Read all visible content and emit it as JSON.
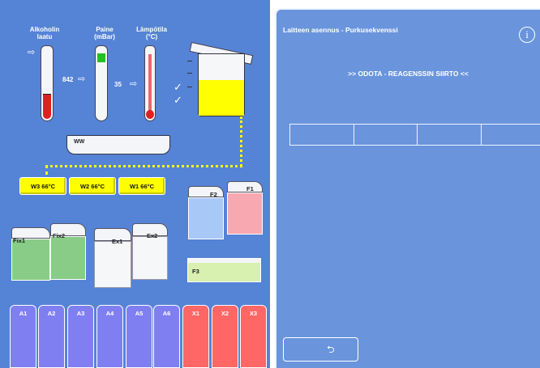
{
  "sensors": {
    "alcohol": {
      "label_line1": "Alkoholin",
      "label_line2": "laatu",
      "value": "842",
      "level": 0.32
    },
    "pressure": {
      "label_line1": "Paine",
      "label_line2": "(mBar)",
      "value": "35",
      "level": 0.1
    },
    "temperature": {
      "label_line1": "Lämpötila",
      "label_line2": "(°C)",
      "level": 0.1
    }
  },
  "ww_label": "WW",
  "wax": [
    {
      "label": "W3 66°C"
    },
    {
      "label": "W2 66°C"
    },
    {
      "label": "W1 66°C"
    }
  ],
  "containers": {
    "fix1": "Fix1",
    "fix2": "Fix2",
    "ex1": "Ex1",
    "ex2": "Ex2",
    "f1": "F1",
    "f2": "F2",
    "f3": "F3"
  },
  "bottles": [
    {
      "label": "A1",
      "color": "#7f7ff2"
    },
    {
      "label": "A2",
      "color": "#7f7ff2"
    },
    {
      "label": "A3",
      "color": "#7f7ff2"
    },
    {
      "label": "A4",
      "color": "#7f7ff2"
    },
    {
      "label": "A5",
      "color": "#7f7ff2"
    },
    {
      "label": "A6",
      "color": "#7f7ff2"
    },
    {
      "label": "X1",
      "color": "#ff6666"
    },
    {
      "label": "X2",
      "color": "#ff6666"
    },
    {
      "label": "X3",
      "color": "#ff6666"
    }
  ],
  "panel": {
    "title": "Laitteen asennus - Purkusekvenssi",
    "status": ">> ODOTA - REAGENSSIN SIIRTO <<",
    "info_icon": "info-icon",
    "back_icon": "return-arrow-icon"
  },
  "colors": {
    "background": "#5583d6",
    "panel": "#6a95dd",
    "yellow": "#ffff00",
    "alcohol_fill": "#e02020",
    "pressure_fill": "#22c022"
  }
}
